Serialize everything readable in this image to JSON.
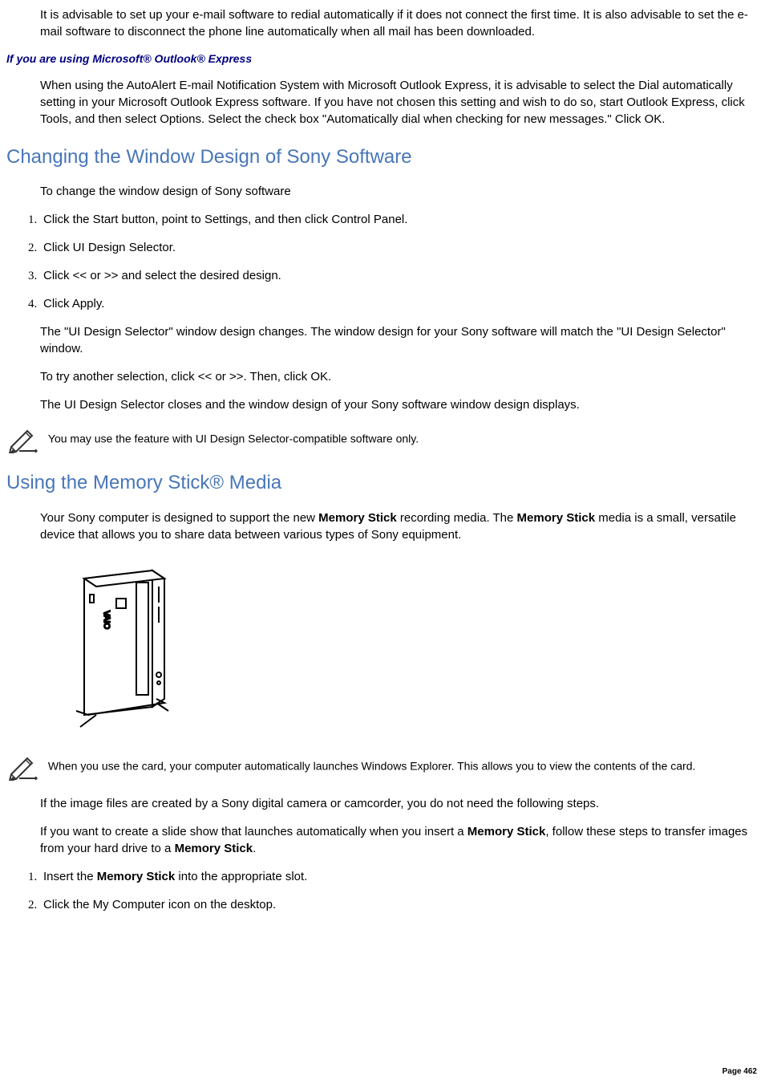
{
  "para_intro": "It is advisable to set up your e-mail software to redial automatically if it does not connect the first time. It is also advisable to set the e-mail software to disconnect the phone line automatically when all mail has been downloaded.",
  "subheading_outlook": "If you are using Microsoft® Outlook® Express",
  "para_outlook": "When using the AutoAlert E-mail Notification System with Microsoft Outlook Express, it is advisable to select the Dial automatically setting in your Microsoft Outlook Express software. If you have not chosen this setting and wish to do so, start Outlook Express, click Tools, and then select Options. Select the check box \"Automatically dial when checking for new messages.\" Click OK.",
  "heading_changing": "Changing the Window Design of Sony Software",
  "para_changing_intro": "To change the window design of Sony software",
  "list_changing": [
    "Click the Start button, point to Settings, and then click Control Panel.",
    "Click UI Design Selector.",
    "Click << or >> and select the desired design.",
    "Click Apply."
  ],
  "para_changing_1": "The \"UI Design Selector\" window design changes. The window design for your Sony software will match the \"UI Design Selector\" window.",
  "para_changing_2": "To try another selection, click << or >>. Then, click OK.",
  "para_changing_3": "The UI Design Selector closes and the window design of your Sony software window design displays.",
  "note_changing": "You may use the feature with UI Design Selector-compatible software only.",
  "heading_memory": "Using the Memory Stick® Media",
  "memory_intro_1": "Your Sony computer is designed to support the new ",
  "memory_intro_bold1": "Memory Stick",
  "memory_intro_2": " recording media. The ",
  "memory_intro_bold2": "Memory Stick",
  "memory_intro_3": " media is a small, versatile device that allows you to share data between various types of Sony equipment.",
  "note_memory": "When you use the card, your computer automatically launches Windows Explorer. This allows you to view the contents of the card.",
  "para_memory_1": "If the image files are created by a Sony digital camera or camcorder, you do not need the following steps.",
  "memory_slide_1": "If you want to create a slide show that launches automatically when you insert a ",
  "memory_slide_bold1": "Memory Stick",
  "memory_slide_2": ", follow these steps to transfer images from your hard drive to a ",
  "memory_slide_bold2": "Memory Stick",
  "memory_slide_3": ".",
  "list_memory_1a": "Insert the ",
  "list_memory_1bold": "Memory Stick",
  "list_memory_1b": " into the appropriate slot.",
  "list_memory_2": "Click the My Computer icon on the desktop.",
  "page_number": "Page 462"
}
